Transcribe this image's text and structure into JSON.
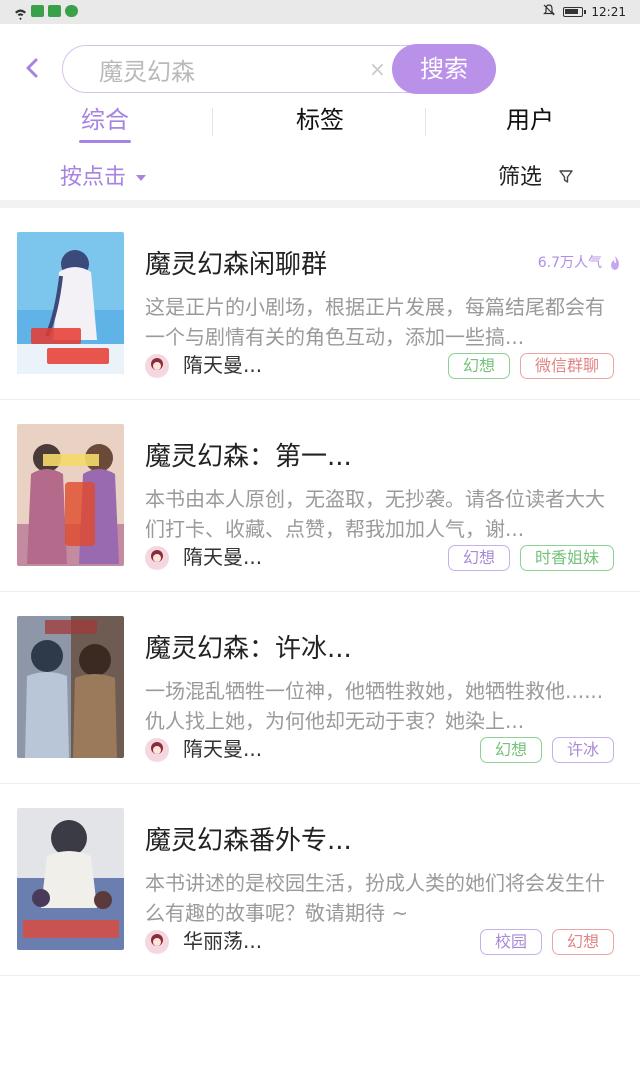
{
  "status_bar": {
    "time": "12:21"
  },
  "header": {
    "back_icon": "chevron-left-icon",
    "search": {
      "value": "魔灵幻森",
      "clear_icon": "clear-icon"
    },
    "search_button": "搜索"
  },
  "tabs": [
    {
      "label": "综合",
      "active": true
    },
    {
      "label": "标签",
      "active": false
    },
    {
      "label": "用户",
      "active": false
    }
  ],
  "filter_bar": {
    "sort_label": "按点击",
    "filter_label": "筛选"
  },
  "results": [
    {
      "title": "魔灵幻森闲聊群",
      "popularity": "6.7万人气",
      "description": "这是正片的小剧场，根据正片发展，每篇结尾都会有一个与剧情有关的角色互动，添加一些搞...",
      "author": "隋天曼...",
      "tags": [
        {
          "label": "幻想",
          "color": "green"
        },
        {
          "label": "微信群聊",
          "color": "red"
        }
      ]
    },
    {
      "title": "魔灵幻森：第一...",
      "description": "本书由本人原创，无盗取，无抄袭。请各位读者大大们打卡、收藏、点赞，帮我加加人气，谢...",
      "author": "隋天曼...",
      "tags": [
        {
          "label": "幻想",
          "color": "purple"
        },
        {
          "label": "时香姐妹",
          "color": "green"
        }
      ]
    },
    {
      "title": "魔灵幻森：许冰...",
      "description": "一场混乱牺牲一位神，他牺牲救她，她牺牲救他......仇人找上她，为何他却无动于衷？她染上...",
      "author": "隋天曼...",
      "tags": [
        {
          "label": "幻想",
          "color": "green"
        },
        {
          "label": "许冰",
          "color": "purple"
        }
      ]
    },
    {
      "title": "魔灵幻森番外专...",
      "description": "本书讲述的是校园生活，扮成人类的她们将会发生什么有趣的故事呢？敬请期待 ~",
      "author": "华丽荡...",
      "tags": [
        {
          "label": "校园",
          "color": "purple"
        },
        {
          "label": "幻想",
          "color": "red"
        }
      ]
    }
  ],
  "colors": {
    "accent": "#a784e1",
    "search_button": "#b991e8"
  }
}
